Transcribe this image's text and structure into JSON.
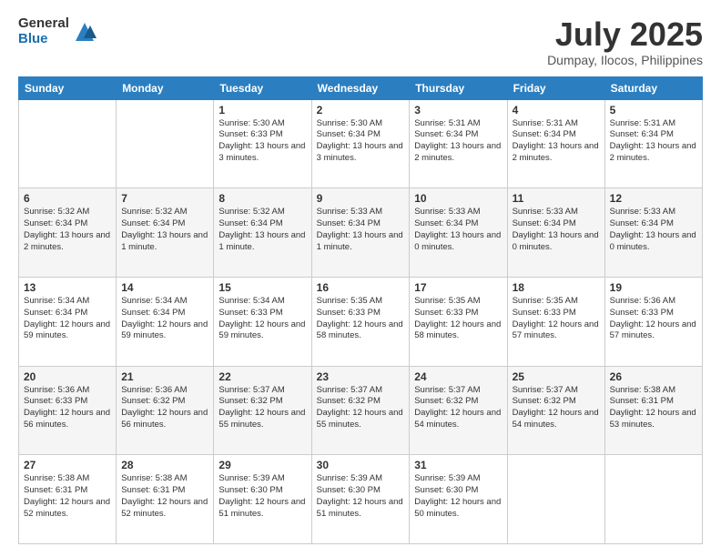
{
  "header": {
    "logo_general": "General",
    "logo_blue": "Blue",
    "month_title": "July 2025",
    "location": "Dumpay, Ilocos, Philippines"
  },
  "calendar": {
    "days_of_week": [
      "Sunday",
      "Monday",
      "Tuesday",
      "Wednesday",
      "Thursday",
      "Friday",
      "Saturday"
    ],
    "weeks": [
      [
        {
          "day": "",
          "info": ""
        },
        {
          "day": "",
          "info": ""
        },
        {
          "day": "1",
          "info": "Sunrise: 5:30 AM\nSunset: 6:33 PM\nDaylight: 13 hours and 3 minutes."
        },
        {
          "day": "2",
          "info": "Sunrise: 5:30 AM\nSunset: 6:34 PM\nDaylight: 13 hours and 3 minutes."
        },
        {
          "day": "3",
          "info": "Sunrise: 5:31 AM\nSunset: 6:34 PM\nDaylight: 13 hours and 2 minutes."
        },
        {
          "day": "4",
          "info": "Sunrise: 5:31 AM\nSunset: 6:34 PM\nDaylight: 13 hours and 2 minutes."
        },
        {
          "day": "5",
          "info": "Sunrise: 5:31 AM\nSunset: 6:34 PM\nDaylight: 13 hours and 2 minutes."
        }
      ],
      [
        {
          "day": "6",
          "info": "Sunrise: 5:32 AM\nSunset: 6:34 PM\nDaylight: 13 hours and 2 minutes."
        },
        {
          "day": "7",
          "info": "Sunrise: 5:32 AM\nSunset: 6:34 PM\nDaylight: 13 hours and 1 minute."
        },
        {
          "day": "8",
          "info": "Sunrise: 5:32 AM\nSunset: 6:34 PM\nDaylight: 13 hours and 1 minute."
        },
        {
          "day": "9",
          "info": "Sunrise: 5:33 AM\nSunset: 6:34 PM\nDaylight: 13 hours and 1 minute."
        },
        {
          "day": "10",
          "info": "Sunrise: 5:33 AM\nSunset: 6:34 PM\nDaylight: 13 hours and 0 minutes."
        },
        {
          "day": "11",
          "info": "Sunrise: 5:33 AM\nSunset: 6:34 PM\nDaylight: 13 hours and 0 minutes."
        },
        {
          "day": "12",
          "info": "Sunrise: 5:33 AM\nSunset: 6:34 PM\nDaylight: 13 hours and 0 minutes."
        }
      ],
      [
        {
          "day": "13",
          "info": "Sunrise: 5:34 AM\nSunset: 6:34 PM\nDaylight: 12 hours and 59 minutes."
        },
        {
          "day": "14",
          "info": "Sunrise: 5:34 AM\nSunset: 6:34 PM\nDaylight: 12 hours and 59 minutes."
        },
        {
          "day": "15",
          "info": "Sunrise: 5:34 AM\nSunset: 6:33 PM\nDaylight: 12 hours and 59 minutes."
        },
        {
          "day": "16",
          "info": "Sunrise: 5:35 AM\nSunset: 6:33 PM\nDaylight: 12 hours and 58 minutes."
        },
        {
          "day": "17",
          "info": "Sunrise: 5:35 AM\nSunset: 6:33 PM\nDaylight: 12 hours and 58 minutes."
        },
        {
          "day": "18",
          "info": "Sunrise: 5:35 AM\nSunset: 6:33 PM\nDaylight: 12 hours and 57 minutes."
        },
        {
          "day": "19",
          "info": "Sunrise: 5:36 AM\nSunset: 6:33 PM\nDaylight: 12 hours and 57 minutes."
        }
      ],
      [
        {
          "day": "20",
          "info": "Sunrise: 5:36 AM\nSunset: 6:33 PM\nDaylight: 12 hours and 56 minutes."
        },
        {
          "day": "21",
          "info": "Sunrise: 5:36 AM\nSunset: 6:32 PM\nDaylight: 12 hours and 56 minutes."
        },
        {
          "day": "22",
          "info": "Sunrise: 5:37 AM\nSunset: 6:32 PM\nDaylight: 12 hours and 55 minutes."
        },
        {
          "day": "23",
          "info": "Sunrise: 5:37 AM\nSunset: 6:32 PM\nDaylight: 12 hours and 55 minutes."
        },
        {
          "day": "24",
          "info": "Sunrise: 5:37 AM\nSunset: 6:32 PM\nDaylight: 12 hours and 54 minutes."
        },
        {
          "day": "25",
          "info": "Sunrise: 5:37 AM\nSunset: 6:32 PM\nDaylight: 12 hours and 54 minutes."
        },
        {
          "day": "26",
          "info": "Sunrise: 5:38 AM\nSunset: 6:31 PM\nDaylight: 12 hours and 53 minutes."
        }
      ],
      [
        {
          "day": "27",
          "info": "Sunrise: 5:38 AM\nSunset: 6:31 PM\nDaylight: 12 hours and 52 minutes."
        },
        {
          "day": "28",
          "info": "Sunrise: 5:38 AM\nSunset: 6:31 PM\nDaylight: 12 hours and 52 minutes."
        },
        {
          "day": "29",
          "info": "Sunrise: 5:39 AM\nSunset: 6:30 PM\nDaylight: 12 hours and 51 minutes."
        },
        {
          "day": "30",
          "info": "Sunrise: 5:39 AM\nSunset: 6:30 PM\nDaylight: 12 hours and 51 minutes."
        },
        {
          "day": "31",
          "info": "Sunrise: 5:39 AM\nSunset: 6:30 PM\nDaylight: 12 hours and 50 minutes."
        },
        {
          "day": "",
          "info": ""
        },
        {
          "day": "",
          "info": ""
        }
      ]
    ]
  }
}
